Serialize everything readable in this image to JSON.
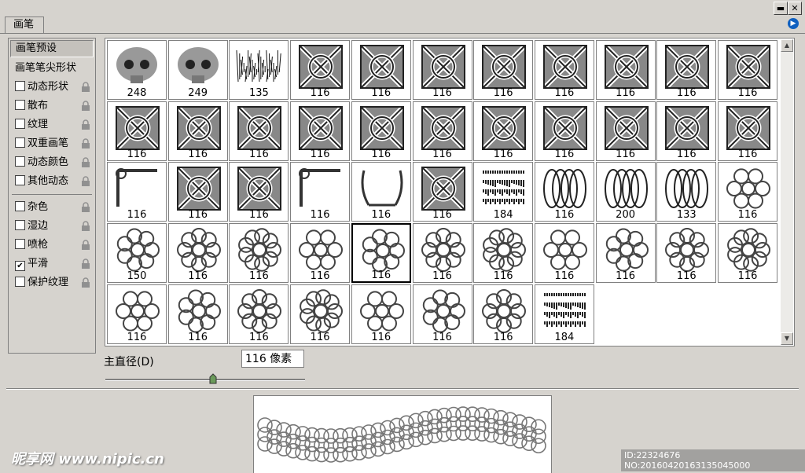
{
  "panel": {
    "tab_label": "画笔",
    "menu_icon": "flyout-arrow-icon"
  },
  "left_panel": {
    "preset_label": "画笔预设",
    "tip_shape_label": "画笔笔尖形状",
    "options": [
      {
        "label": "动态形状",
        "checked": false
      },
      {
        "label": "散布",
        "checked": false
      },
      {
        "label": "纹理",
        "checked": false
      },
      {
        "label": "双重画笔",
        "checked": false
      },
      {
        "label": "动态颜色",
        "checked": false
      },
      {
        "label": "其他动态",
        "checked": false
      }
    ],
    "options2": [
      {
        "label": "杂色",
        "checked": false
      },
      {
        "label": "湿边",
        "checked": false
      },
      {
        "label": "喷枪",
        "checked": false
      },
      {
        "label": "平滑",
        "checked": true
      },
      {
        "label": "保护纹理",
        "checked": false
      }
    ]
  },
  "brushes": [
    {
      "size": "248",
      "kind": "skull"
    },
    {
      "size": "249",
      "kind": "skull"
    },
    {
      "size": "135",
      "kind": "grass"
    },
    {
      "size": "116",
      "kind": "knot"
    },
    {
      "size": "116",
      "kind": "knot"
    },
    {
      "size": "116",
      "kind": "knot"
    },
    {
      "size": "116",
      "kind": "knot"
    },
    {
      "size": "116",
      "kind": "knot"
    },
    {
      "size": "116",
      "kind": "knot"
    },
    {
      "size": "116",
      "kind": "knot"
    },
    {
      "size": "116",
      "kind": "knot"
    },
    {
      "size": "116",
      "kind": "knot"
    },
    {
      "size": "116",
      "kind": "knot"
    },
    {
      "size": "116",
      "kind": "knot"
    },
    {
      "size": "116",
      "kind": "knot"
    },
    {
      "size": "116",
      "kind": "knot"
    },
    {
      "size": "116",
      "kind": "knot"
    },
    {
      "size": "116",
      "kind": "knot"
    },
    {
      "size": "116",
      "kind": "knot"
    },
    {
      "size": "116",
      "kind": "knot"
    },
    {
      "size": "116",
      "kind": "knot"
    },
    {
      "size": "116",
      "kind": "knot"
    },
    {
      "size": "116",
      "kind": "corner"
    },
    {
      "size": "116",
      "kind": "knot"
    },
    {
      "size": "116",
      "kind": "knot"
    },
    {
      "size": "116",
      "kind": "corner"
    },
    {
      "size": "116",
      "kind": "frame"
    },
    {
      "size": "116",
      "kind": "knot"
    },
    {
      "size": "184",
      "kind": "text"
    },
    {
      "size": "116",
      "kind": "rings"
    },
    {
      "size": "200",
      "kind": "chain"
    },
    {
      "size": "133",
      "kind": "chain"
    },
    {
      "size": "116",
      "kind": "circles"
    },
    {
      "size": "150",
      "kind": "circles"
    },
    {
      "size": "116",
      "kind": "circles"
    },
    {
      "size": "116",
      "kind": "circles"
    },
    {
      "size": "116",
      "kind": "circles"
    },
    {
      "size": "116",
      "kind": "circles"
    },
    {
      "size": "116",
      "kind": "circles"
    },
    {
      "size": "116",
      "kind": "circles"
    },
    {
      "size": "116",
      "kind": "circles"
    },
    {
      "size": "116",
      "kind": "circles"
    },
    {
      "size": "116",
      "kind": "circles"
    },
    {
      "size": "116",
      "kind": "circles"
    },
    {
      "size": "116",
      "kind": "circles"
    },
    {
      "size": "116",
      "kind": "circles"
    },
    {
      "size": "116",
      "kind": "circles"
    },
    {
      "size": "116",
      "kind": "circles"
    },
    {
      "size": "116",
      "kind": "circles"
    },
    {
      "size": "116",
      "kind": "circles"
    },
    {
      "size": "116",
      "kind": "circles"
    },
    {
      "size": "184",
      "kind": "text"
    }
  ],
  "selected_index": 37,
  "diameter": {
    "label": "主直径(D)",
    "value": "116 像素",
    "slider_fraction": 0.54
  },
  "watermark": {
    "left": "昵享网 www.nipic.cn",
    "right": "ID:22324676 NO:20160420163135045000"
  }
}
